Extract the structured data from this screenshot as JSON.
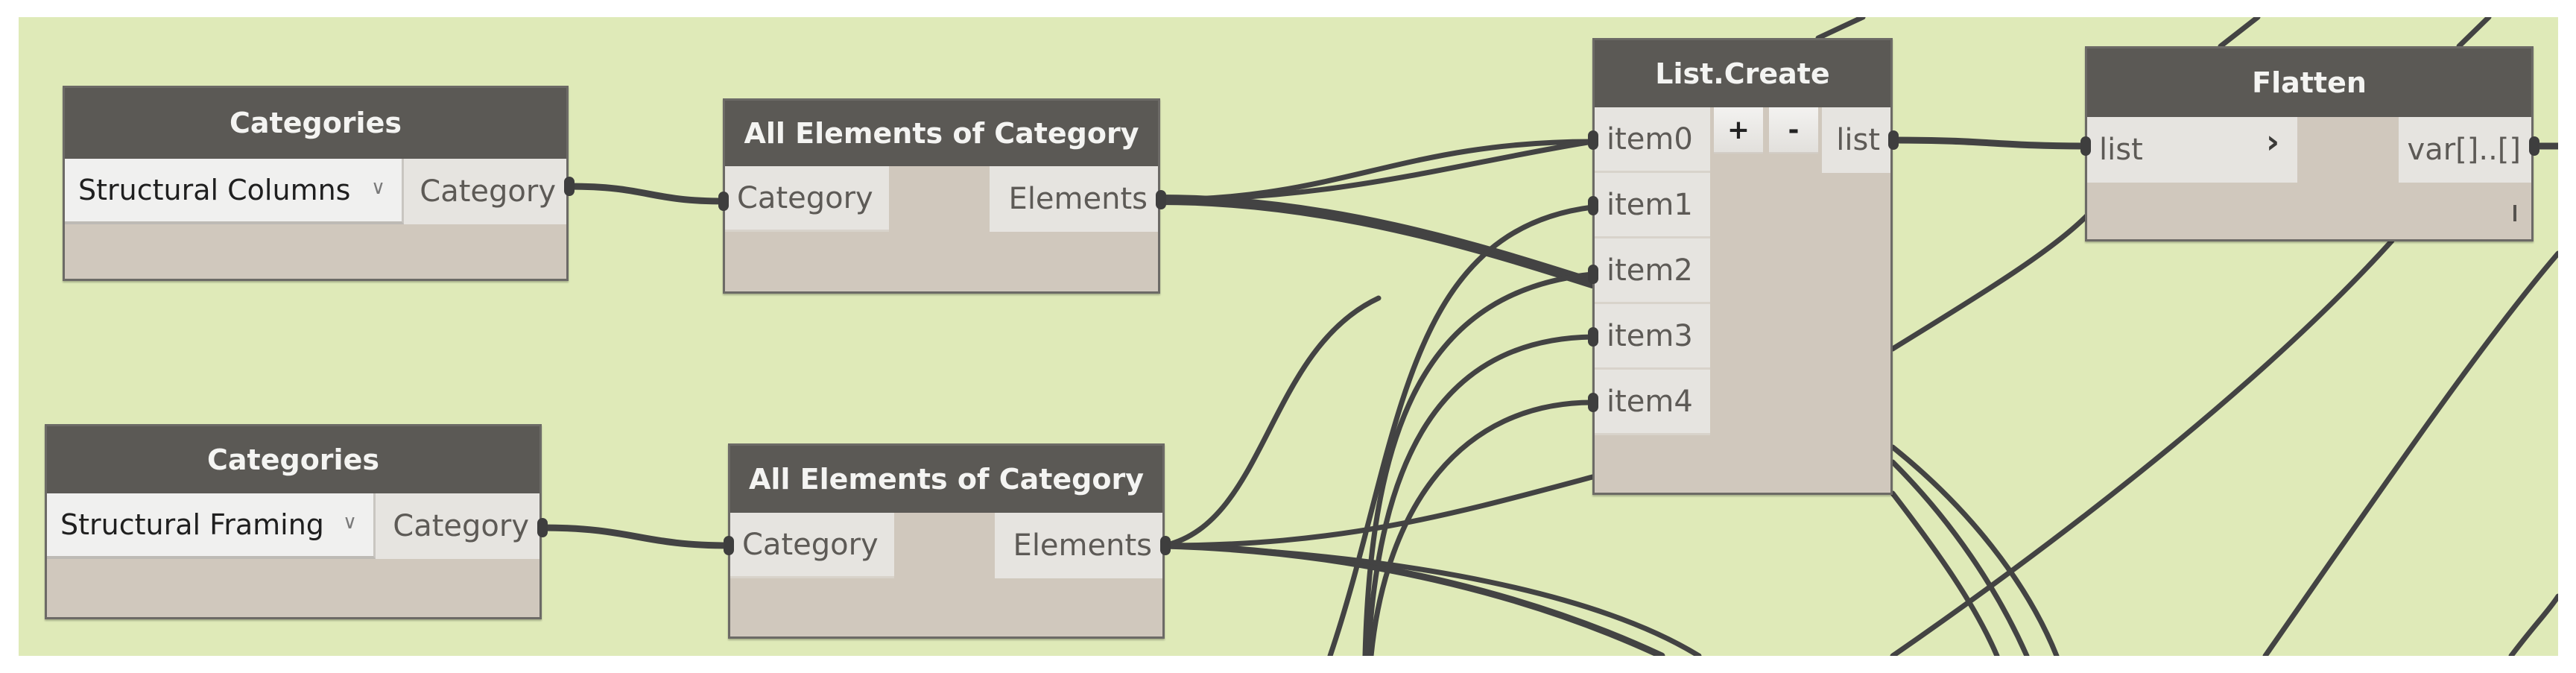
{
  "canvas": {
    "background": "#dfeab8",
    "wire_color": "#434343",
    "header_color": "#5b5955",
    "body_color": "#d0c8bd"
  },
  "nodes": {
    "categories_1": {
      "title": "Categories",
      "selected": "Structural Columns",
      "output": "Category"
    },
    "all_elements_1": {
      "title": "All Elements of Category",
      "input": "Category",
      "output": "Elements"
    },
    "categories_2": {
      "title": "Categories",
      "selected": "Structural Framing",
      "output": "Category"
    },
    "all_elements_2": {
      "title": "All Elements of Category",
      "input": "Category",
      "output": "Elements"
    },
    "list_create": {
      "title": "List.Create",
      "inputs": [
        "item0",
        "item1",
        "item2",
        "item3",
        "item4"
      ],
      "add_label": "+",
      "remove_label": "-",
      "output": "list"
    },
    "flatten": {
      "title": "Flatten",
      "input": "list",
      "output": "var[]..[]",
      "lacing_icon": "chevron-right",
      "lacing_mark": "I"
    }
  }
}
